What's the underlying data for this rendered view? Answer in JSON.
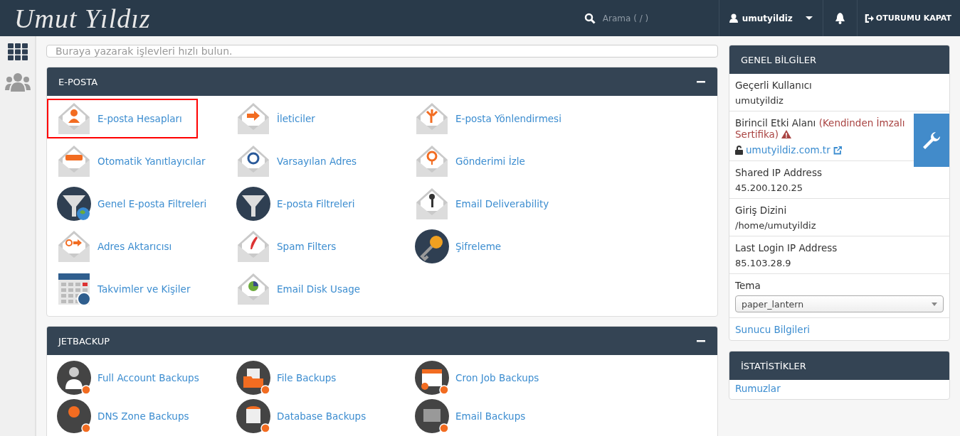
{
  "header": {
    "logo": "Umut Yıldız",
    "search_placeholder": "Arama ( / )",
    "user": "umutyildiz",
    "logout": "OTURUMU KAPAT"
  },
  "quick_search": {
    "placeholder": "Buraya yazarak işlevleri hızlı bulun."
  },
  "sections": [
    {
      "title": "E-POSTA",
      "expanded": true,
      "items": [
        {
          "label": "E-posta Hesapları",
          "highlighted": true
        },
        {
          "label": "İleticiler",
          "highlighted": false
        },
        {
          "label": "E-posta Yönlendirmesi",
          "highlighted": false
        },
        {
          "label": "Otomatik Yanıtlayıcılar",
          "highlighted": false
        },
        {
          "label": "Varsayılan Adres",
          "highlighted": false
        },
        {
          "label": "Gönderimi İzle",
          "highlighted": false
        },
        {
          "label": "Genel E-posta Filtreleri",
          "highlighted": false
        },
        {
          "label": "E-posta Filtreleri",
          "highlighted": false
        },
        {
          "label": "Email Deliverability",
          "highlighted": false
        },
        {
          "label": "Adres Aktarıcısı",
          "highlighted": false
        },
        {
          "label": "Spam Filters",
          "highlighted": false
        },
        {
          "label": "Şifreleme",
          "highlighted": false
        },
        {
          "label": "Takvimler ve Kişiler",
          "highlighted": false
        },
        {
          "label": "Email Disk Usage",
          "highlighted": false
        }
      ]
    },
    {
      "title": "JETBACKUP",
      "expanded": true,
      "items": [
        {
          "label": "Full Account Backups",
          "highlighted": false
        },
        {
          "label": "File Backups",
          "highlighted": false
        },
        {
          "label": "Cron Job Backups",
          "highlighted": false
        },
        {
          "label": "DNS Zone Backups",
          "highlighted": false
        },
        {
          "label": "Database Backups",
          "highlighted": false
        },
        {
          "label": "Email Backups",
          "highlighted": false
        }
      ]
    }
  ],
  "general_info": {
    "title": "GENEL BİLGİLER",
    "rows": [
      {
        "kind": "text",
        "label": "Geçerli Kullanıcı",
        "value": "umutyildiz"
      },
      {
        "kind": "domain",
        "label": "Birincil Etki Alanı",
        "note": "(Kendinden İmzalı Sertifika)",
        "link": "umutyildiz.com.tr"
      },
      {
        "kind": "text",
        "label": "Shared IP Address",
        "value": "45.200.120.25"
      },
      {
        "kind": "text",
        "label": "Giriş Dizini",
        "value": "/home/umutyildiz"
      },
      {
        "kind": "text",
        "label": "Last Login IP Address",
        "value": "85.103.28.9"
      },
      {
        "kind": "select",
        "label": "Tema",
        "value": "paper_lantern"
      },
      {
        "kind": "link",
        "label": "Sunucu Bilgileri"
      }
    ]
  },
  "statistics": {
    "title": "İSTATİSTİKLER",
    "items": [
      "Rumuzlar"
    ]
  }
}
